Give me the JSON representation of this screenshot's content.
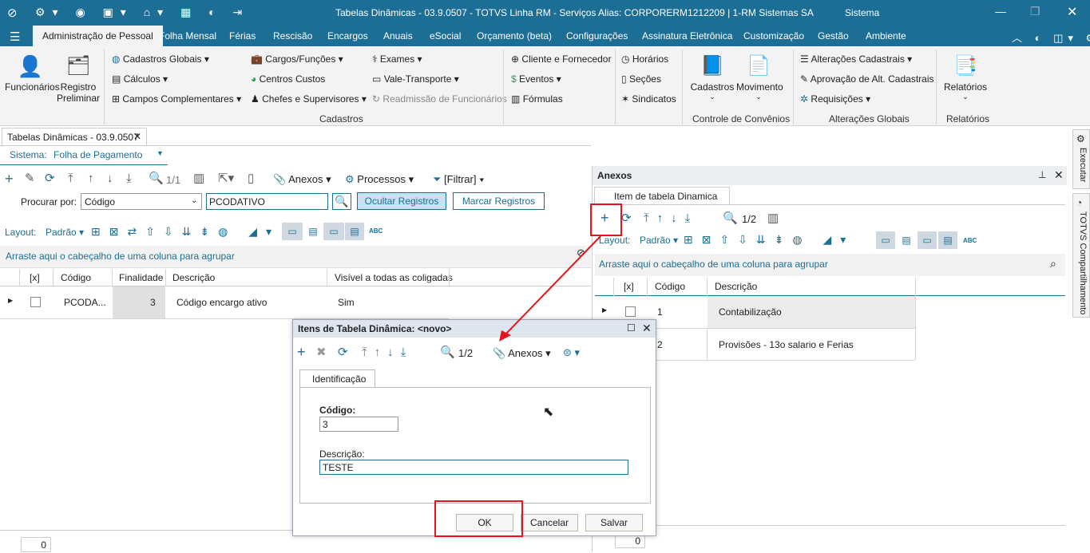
{
  "window": {
    "title": "Tabelas Dinâmicas - 03.9.0507 - TOTVS Linha RM - Serviços  Alias: CORPORERM1212209 | 1-RM Sistemas SA",
    "sistema_tab": "Sistema"
  },
  "ribbon_tabs": [
    "Administração de Pessoal",
    "Folha Mensal",
    "Férias",
    "Rescisão",
    "Encargos",
    "Anuais",
    "eSocial",
    "Orçamento (beta)",
    "Configurações",
    "Assinatura Eletrônica",
    "Customização",
    "Gestão",
    "Ambiente"
  ],
  "ribbon": {
    "funcionarios": "Funcionários",
    "registro1": "Registro",
    "registro2": "Preliminar",
    "cadastros_globais": "Cadastros Globais",
    "calculos": "Cálculos",
    "campos_complementares": "Campos Complementares",
    "cargos_funcoes": "Cargos/Funções",
    "centros_custos": "Centros Custos",
    "chefes_supervisores": "Chefes e Supervisores",
    "exames": "Exames",
    "vale_transporte": "Vale-Transporte",
    "readmissao": "Readmissão de Funcionários",
    "cliente_fornecedor": "Cliente e Fornecedor",
    "eventos": "Eventos",
    "formulas": "Fórmulas",
    "horarios": "Horários",
    "secoes": "Seções",
    "sindicatos": "Sindicatos",
    "cadastros_big": "Cadastros",
    "movimento": "Movimento",
    "alteracoes_cadastrais": "Alterações Cadastrais",
    "aprovacao": "Aprovação de Alt. Cadastrais",
    "requisicoes": "Requisições",
    "relatorios_big": "Relatórios",
    "group_cadastros": "Cadastros",
    "group_convenios": "Controle de Convênios",
    "group_alteracoes": "Alterações Globais",
    "group_relatorios": "Relatórios"
  },
  "doc_tab": {
    "label": "Tabelas Dinâmicas - 03.9.0507",
    "close": "✕"
  },
  "sistema": {
    "label": "Sistema:",
    "value": "Folha de Pagamento"
  },
  "main_toolbar": {
    "page": "1/1",
    "anexos": "Anexos",
    "processos": "Processos",
    "filtrar": "[Filtrar]"
  },
  "search": {
    "label": "Procurar por:",
    "field": "Código",
    "value": "PCODATIVO",
    "ocultar": "Ocultar Registros",
    "marcar": "Marcar Registros"
  },
  "layout": {
    "label": "Layout:",
    "value": "Padrão"
  },
  "group_hint": "Arraste aqui o cabeçalho de uma coluna para agrupar",
  "main_grid": {
    "headers": [
      "[x]",
      "Código",
      "Finalidade",
      "Descrição",
      "Visível a todas as coligadas"
    ],
    "row": {
      "codigo": "PCODA...",
      "finalidade": "3",
      "descricao": "Código encargo ativo",
      "visivel": "Sim"
    }
  },
  "main_footer": {
    "count": "0"
  },
  "anexos": {
    "title": "Anexos",
    "tab": "Item de tabela Dinamica",
    "page": "1/2",
    "layout_label": "Layout:",
    "layout_value": "Padrão",
    "group_hint": "Arraste aqui o cabeçalho de uma coluna para agrupar",
    "headers": [
      "[x]",
      "Código",
      "Descrição"
    ],
    "rows": [
      {
        "codigo": "1",
        "descricao": "Contabilização"
      },
      {
        "codigo": "2",
        "descricao": "Provisões - 13o salario e Ferias"
      }
    ],
    "footer_count": "0"
  },
  "side_tabs": [
    "Executar",
    "TOTVS Compartilhamento"
  ],
  "dialog": {
    "title": "Itens de Tabela Dinâmica: <novo>",
    "page": "1/2",
    "anexos": "Anexos",
    "tab": "Identificação",
    "codigo_label": "Código:",
    "codigo_value": "3",
    "descricao_label": "Descrição:",
    "descricao_value": "TESTE",
    "ok": "OK",
    "cancelar": "Cancelar",
    "salvar": "Salvar"
  },
  "colors": {
    "titlebar": "#1d6e95",
    "accent": "#1d6e95",
    "highlight": "#e3161e"
  }
}
